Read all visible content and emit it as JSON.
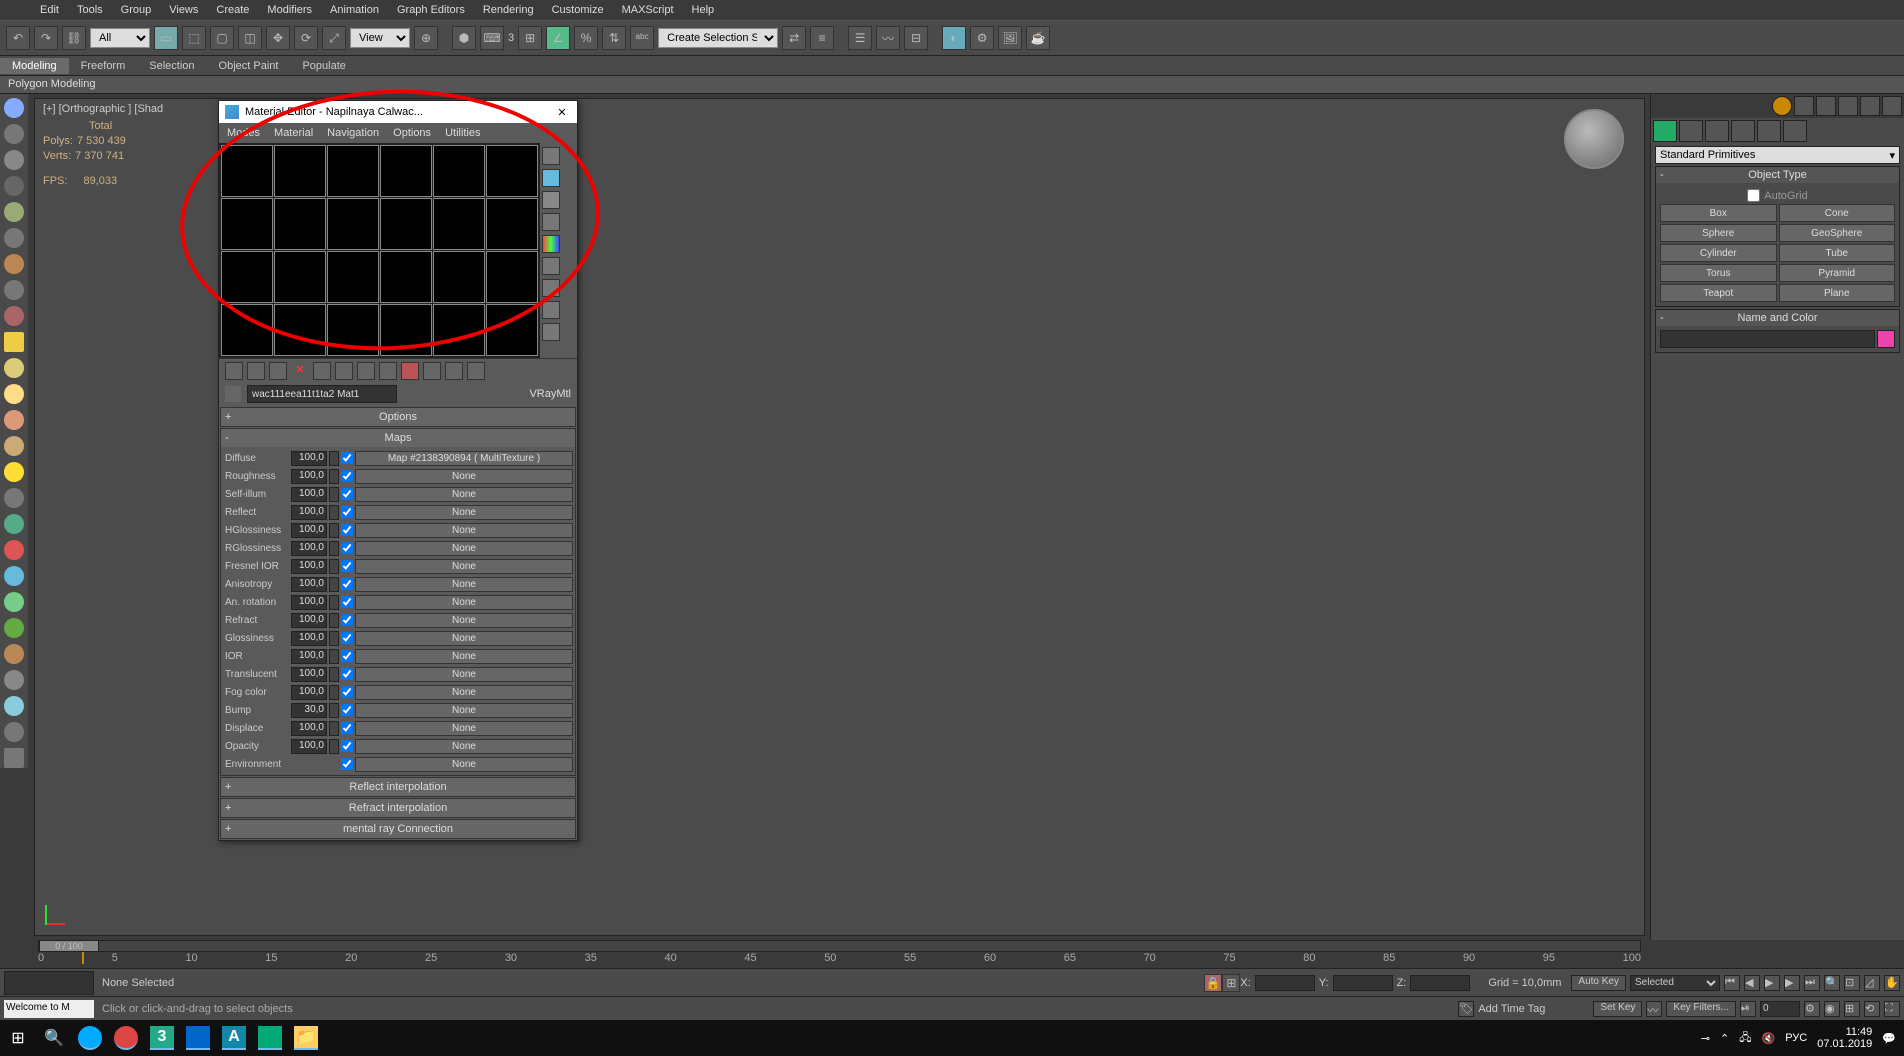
{
  "menubar": [
    "Edit",
    "Tools",
    "Group",
    "Views",
    "Create",
    "Modifiers",
    "Animation",
    "Graph Editors",
    "Rendering",
    "Customize",
    "MAXScript",
    "Help"
  ],
  "toolbar": {
    "all_drop": "All",
    "view_drop": "View",
    "sel_set": "Create Selection Se",
    "num3": "3"
  },
  "ribbon": {
    "tabs": [
      "Modeling",
      "Freeform",
      "Selection",
      "Object Paint",
      "Populate"
    ],
    "sub": "Polygon Modeling"
  },
  "viewport": {
    "label": "[+] [Orthographic ] [Shad",
    "stats": {
      "total": "Total",
      "polys_lbl": "Polys:",
      "polys": "7 530 439",
      "verts_lbl": "Verts:",
      "verts": "7 370 741",
      "fps_lbl": "FPS:",
      "fps": "89,033"
    }
  },
  "mat_editor": {
    "title": "Material Editor - Napilnaya Calwac...",
    "menu": [
      "Modes",
      "Material",
      "Navigation",
      "Options",
      "Utilities"
    ],
    "mat_name": "wac111eea11t1ta2 Mat1",
    "mat_type": "VRayMtl",
    "rollouts": {
      "options": "Options",
      "maps": "Maps",
      "reflect_interp": "Reflect interpolation",
      "refract_interp": "Refract interpolation",
      "mental": "mental ray Connection"
    },
    "maps": [
      {
        "lbl": "Diffuse",
        "val": "100,0",
        "btn": "Map #2138390894 ( MultiTexture )"
      },
      {
        "lbl": "Roughness",
        "val": "100,0",
        "btn": "None"
      },
      {
        "lbl": "Self-illum",
        "val": "100,0",
        "btn": "None"
      },
      {
        "lbl": "Reflect",
        "val": "100,0",
        "btn": "None"
      },
      {
        "lbl": "HGlossiness",
        "val": "100,0",
        "btn": "None"
      },
      {
        "lbl": "RGlossiness",
        "val": "100,0",
        "btn": "None"
      },
      {
        "lbl": "Fresnel IOR",
        "val": "100,0",
        "btn": "None"
      },
      {
        "lbl": "Anisotropy",
        "val": "100,0",
        "btn": "None"
      },
      {
        "lbl": "An. rotation",
        "val": "100,0",
        "btn": "None"
      },
      {
        "lbl": "Refract",
        "val": "100,0",
        "btn": "None"
      },
      {
        "lbl": "Glossiness",
        "val": "100,0",
        "btn": "None"
      },
      {
        "lbl": "IOR",
        "val": "100,0",
        "btn": "None"
      },
      {
        "lbl": "Translucent",
        "val": "100,0",
        "btn": "None"
      },
      {
        "lbl": "Fog color",
        "val": "100,0",
        "btn": "None"
      },
      {
        "lbl": "Bump",
        "val": "30,0",
        "btn": "None"
      },
      {
        "lbl": "Displace",
        "val": "100,0",
        "btn": "None"
      },
      {
        "lbl": "Opacity",
        "val": "100,0",
        "btn": "None"
      },
      {
        "lbl": "Environment",
        "val": "",
        "btn": "None"
      }
    ]
  },
  "cmd": {
    "dropdown": "Standard Primitives",
    "obj_type": "Object Type",
    "autogrid": "AutoGrid",
    "buttons": [
      "Box",
      "Cone",
      "Sphere",
      "GeoSphere",
      "Cylinder",
      "Tube",
      "Torus",
      "Pyramid",
      "Teapot",
      "Plane"
    ],
    "name_color": "Name and Color"
  },
  "timeline": {
    "slider": "0 / 100",
    "ticks": [
      "0",
      "5",
      "10",
      "15",
      "20",
      "25",
      "30",
      "35",
      "40",
      "45",
      "50",
      "55",
      "60",
      "65",
      "70",
      "75",
      "80",
      "85",
      "90",
      "95",
      "100"
    ]
  },
  "status": {
    "none_selected": "None Selected",
    "welcome": "Welcome to M",
    "hint": "Click or click-and-drag to select objects",
    "x": "X:",
    "y": "Y:",
    "z": "Z:",
    "grid": "Grid = 10,0mm",
    "autokey": "Auto Key",
    "setkey": "Set Key",
    "selected": "Selected",
    "keyfilters": "Key Filters...",
    "addtag": "Add Time Tag",
    "frame0": "0"
  },
  "taskbar": {
    "lang": "РУС",
    "time": "11:49",
    "date": "07.01.2019"
  }
}
